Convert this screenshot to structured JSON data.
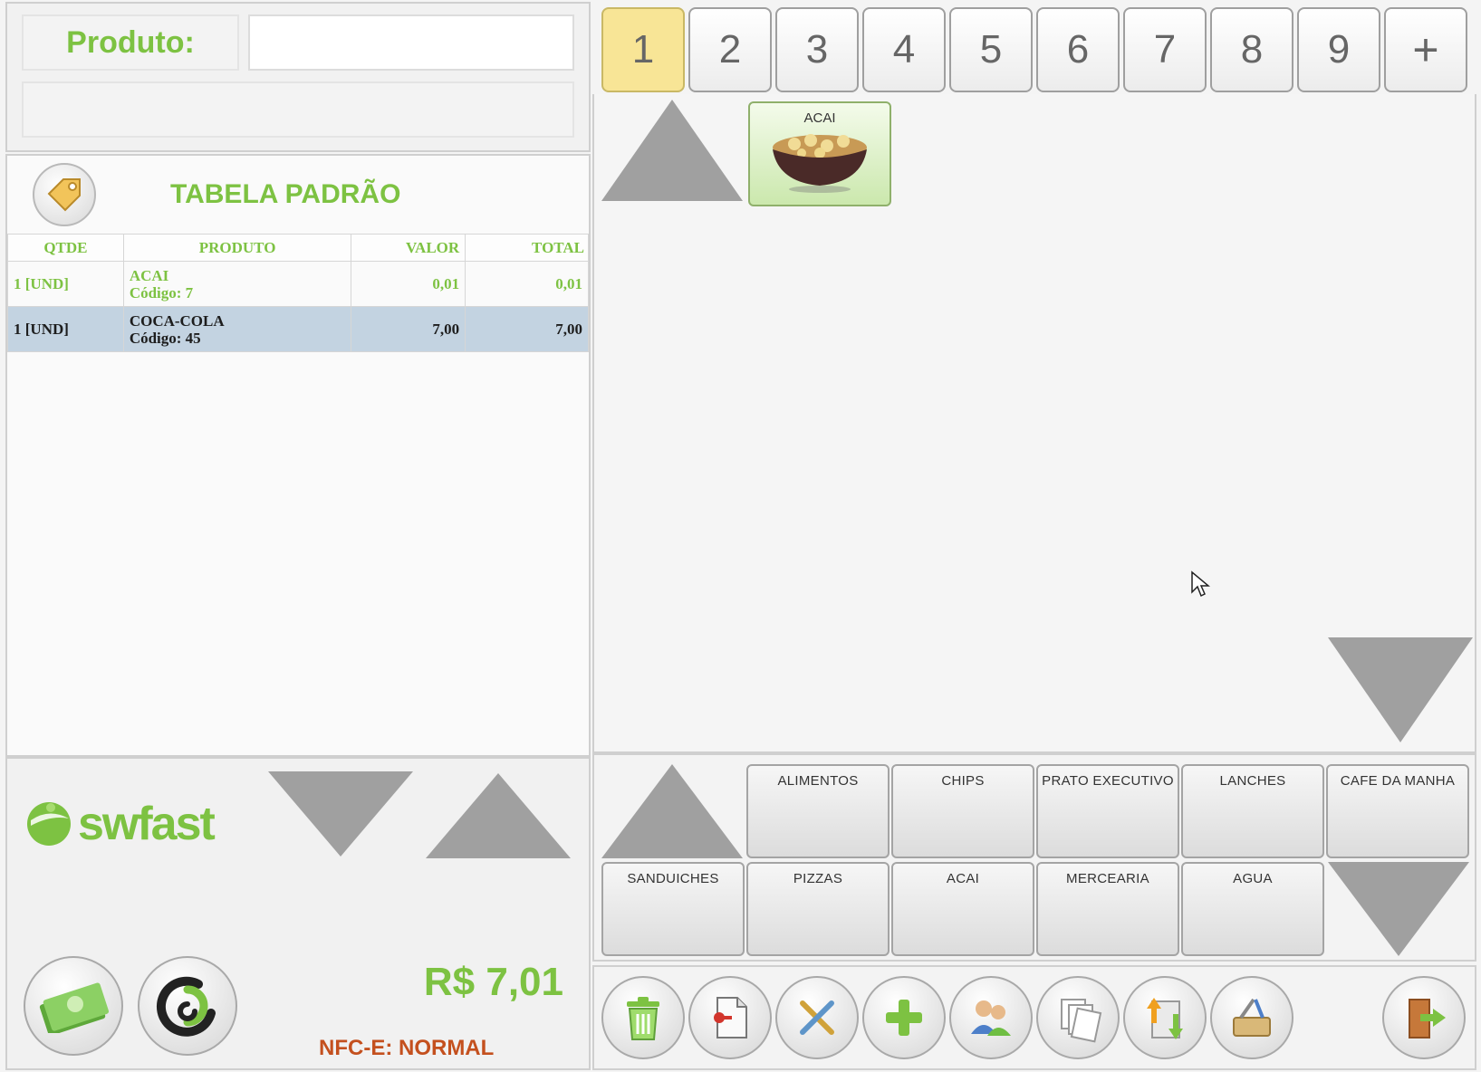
{
  "product_entry": {
    "label": "Produto:",
    "input_value": "",
    "description": ""
  },
  "price_table": {
    "title": "TABELA PADRÃO",
    "icon": "price-tag-icon"
  },
  "items_table": {
    "headers": [
      "QTDE",
      "PRODUTO",
      "VALOR",
      "TOTAL"
    ],
    "rows": [
      {
        "qty": "1 [UND]",
        "name": "ACAI",
        "code": "Código: 7",
        "value": "0,01",
        "total": "0,01",
        "selected": false
      },
      {
        "qty": "1 [UND]",
        "name": "COCA-COLA",
        "code": "Código: 45",
        "value": "7,00",
        "total": "7,00",
        "selected": true
      }
    ]
  },
  "branding": {
    "logo_text": "swfast"
  },
  "summary": {
    "total": "R$ 7,01",
    "nfce_status": "NFC-E: NORMAL"
  },
  "tabs": {
    "items": [
      "1",
      "2",
      "3",
      "4",
      "5",
      "6",
      "7",
      "8",
      "9",
      "+"
    ],
    "active": "1"
  },
  "products": [
    {
      "label": "ACAI",
      "icon": "acai-bowl-image"
    }
  ],
  "categories": [
    "ALIMENTOS",
    "CHIPS",
    "PRATO EXECUTIVO",
    "LANCHES",
    "CAFE DA MANHA",
    "SANDUICHES",
    "PIZZAS",
    "ACAI",
    "MERCEARIA",
    "AGUA"
  ],
  "toolbar": [
    {
      "name": "delete-button",
      "icon": "trash-icon"
    },
    {
      "name": "document-button",
      "icon": "document-icon"
    },
    {
      "name": "cancel-tools-button",
      "icon": "cross-tools-icon"
    },
    {
      "name": "add-button",
      "icon": "plus-icon"
    },
    {
      "name": "customers-button",
      "icon": "users-icon"
    },
    {
      "name": "copies-button",
      "icon": "pages-icon"
    },
    {
      "name": "transfer-button",
      "icon": "transfer-arrows-icon"
    },
    {
      "name": "tools-button",
      "icon": "toolbox-icon"
    },
    {
      "name": "exit-button",
      "icon": "exit-door-icon"
    }
  ],
  "colors": {
    "accent_green": "#7dc242",
    "active_tab": "#f8e596",
    "selected_row": "#c3d3e1",
    "status_orange": "#c4501e"
  }
}
